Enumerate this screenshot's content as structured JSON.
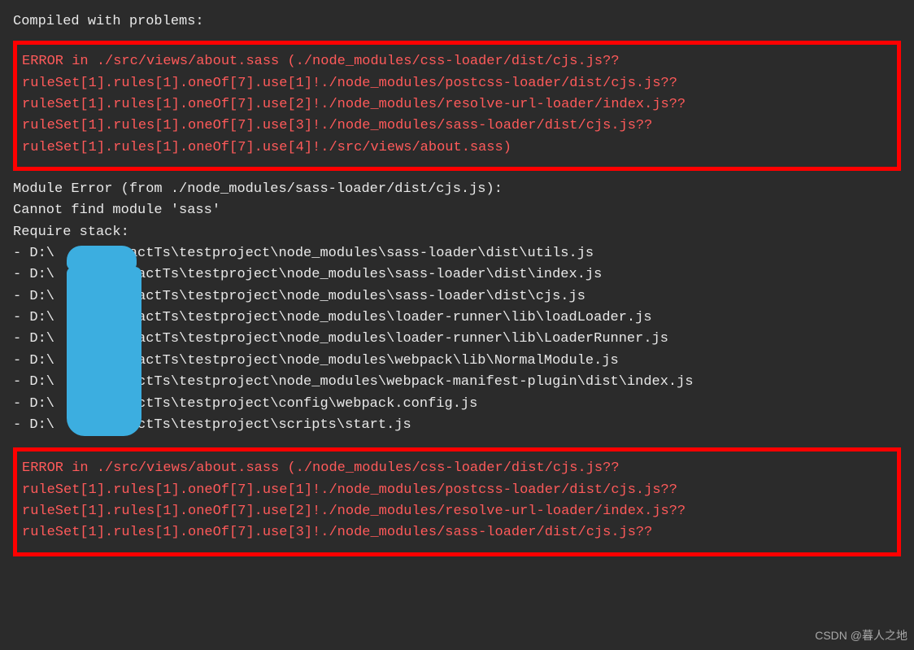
{
  "header": "Compiled with problems:",
  "error1": {
    "lines": [
      "ERROR in ./src/views/about.sass (./node_modules/css-loader/dist/cjs.js??",
      "ruleSet[1].rules[1].oneOf[7].use[1]!./node_modules/postcss-loader/dist/cjs.js??",
      "ruleSet[1].rules[1].oneOf[7].use[2]!./node_modules/resolve-url-loader/index.js??",
      "ruleSet[1].rules[1].oneOf[7].use[3]!./node_modules/sass-loader/dist/cjs.js??",
      "ruleSet[1].rules[1].oneOf[7].use[4]!./src/views/about.sass)"
    ]
  },
  "module_error": {
    "line1": "Module Error (from ./node_modules/sass-loader/dist/cjs.js):",
    "line2": "Cannot find module 'sass'",
    "line3": "Require stack:",
    "stack": [
      "- D:\\       ReactTs\\testproject\\node_modules\\sass-loader\\dist\\utils.js",
      "- D:\\       \\ReactTs\\testproject\\node_modules\\sass-loader\\dist\\index.js",
      "- D:\\       \\ReactTs\\testproject\\node_modules\\sass-loader\\dist\\cjs.js",
      "- D:\\       \\ReactTs\\testproject\\node_modules\\loader-runner\\lib\\loadLoader.js",
      "- D:\\       \\ReactTs\\testproject\\node_modules\\loader-runner\\lib\\LoaderRunner.js",
      "- D:\\       \\ReactTs\\testproject\\node_modules\\webpack\\lib\\NormalModule.js",
      "- D:\\      \\ReactTs\\testproject\\node_modules\\webpack-manifest-plugin\\dist\\index.js",
      "- D:\\      \\ReactTs\\testproject\\config\\webpack.config.js",
      "- D:\\      \\ReactTs\\testproject\\scripts\\start.js"
    ]
  },
  "error2": {
    "lines": [
      "ERROR in ./src/views/about.sass (./node_modules/css-loader/dist/cjs.js??",
      "ruleSet[1].rules[1].oneOf[7].use[1]!./node_modules/postcss-loader/dist/cjs.js??",
      "ruleSet[1].rules[1].oneOf[7].use[2]!./node_modules/resolve-url-loader/index.js??",
      "ruleSet[1].rules[1].oneOf[7].use[3]!./node_modules/sass-loader/dist/cjs.js??"
    ]
  },
  "watermark": "CSDN @暮人之地"
}
